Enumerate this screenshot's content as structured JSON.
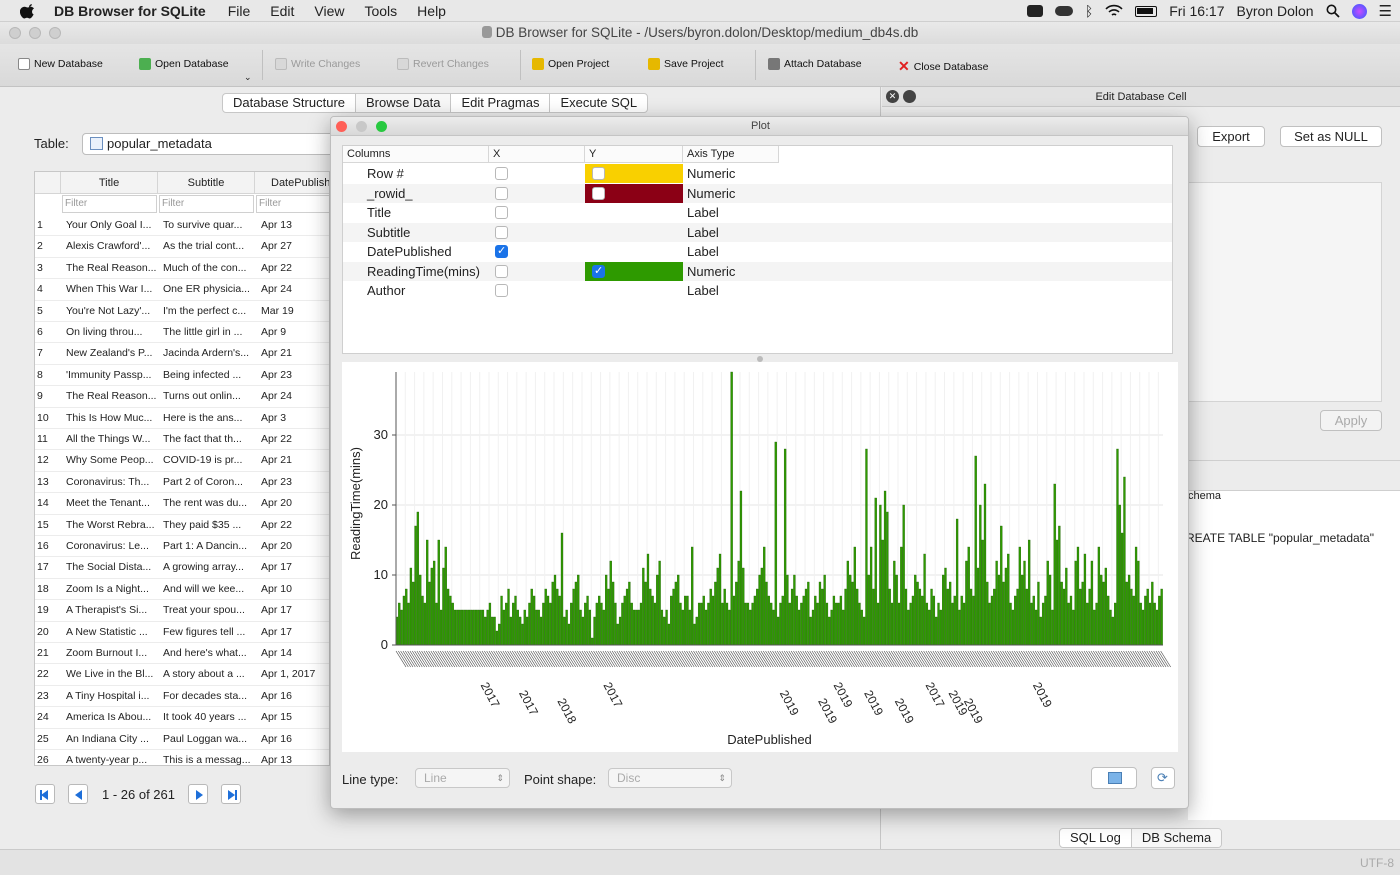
{
  "menubar": {
    "app_name": "DB Browser for SQLite",
    "items": [
      "File",
      "Edit",
      "View",
      "Tools",
      "Help"
    ],
    "clock": "Fri 16:17",
    "user": "Byron Dolon"
  },
  "window": {
    "title": "DB Browser for SQLite - /Users/byron.dolon/Desktop/medium_db4s.db"
  },
  "toolbar": {
    "new_db": "New Database",
    "open_db": "Open Database",
    "write": "Write Changes",
    "revert": "Revert Changes",
    "open_project": "Open Project",
    "save_project": "Save Project",
    "attach": "Attach Database",
    "close": "Close Database"
  },
  "tabs": [
    "Database Structure",
    "Browse Data",
    "Edit Pragmas",
    "Execute SQL"
  ],
  "browse": {
    "table_label": "Table:",
    "table_name": "popular_metadata",
    "columns": [
      "Title",
      "Subtitle",
      "DatePublished"
    ],
    "filter_placeholder": "Filter",
    "rows": [
      [
        "1",
        "Your Only Goal I...",
        "To survive quar...",
        "Apr 13"
      ],
      [
        "2",
        "Alexis Crawford'...",
        "As the trial cont...",
        "Apr 27"
      ],
      [
        "3",
        "The Real Reason...",
        "Much of the con...",
        "Apr 22"
      ],
      [
        "4",
        "When This War I...",
        "One ER physicia...",
        "Apr 24"
      ],
      [
        "5",
        "You're Not Lazy'...",
        "I'm the perfect c...",
        "Mar 19"
      ],
      [
        "6",
        "On living throu...",
        "The little girl in ...",
        "Apr 9"
      ],
      [
        "7",
        "New Zealand's P...",
        "Jacinda Ardern's...",
        "Apr 21"
      ],
      [
        "8",
        "'Immunity Passp...",
        "Being infected ...",
        "Apr 23"
      ],
      [
        "9",
        "The Real Reason...",
        "Turns out onlin...",
        "Apr 24"
      ],
      [
        "10",
        "This Is How Muc...",
        "Here is the ans...",
        "Apr 3"
      ],
      [
        "11",
        "All the Things W...",
        "The fact that th...",
        "Apr 22"
      ],
      [
        "12",
        "Why Some Peop...",
        "COVID-19 is pr...",
        "Apr 21"
      ],
      [
        "13",
        "Coronavirus: Th...",
        "Part 2 of Coron...",
        "Apr 23"
      ],
      [
        "14",
        "Meet the Tenant...",
        "The rent was du...",
        "Apr 20"
      ],
      [
        "15",
        "The Worst Rebra...",
        "They paid $35 ...",
        "Apr 22"
      ],
      [
        "16",
        "Coronavirus: Le...",
        "Part 1: A Dancin...",
        "Apr 20"
      ],
      [
        "17",
        "The Social Dista...",
        "A growing array...",
        "Apr 17"
      ],
      [
        "18",
        "Zoom Is a Night...",
        "And will we kee...",
        "Apr 10"
      ],
      [
        "19",
        "A Therapist's Si...",
        "Treat your spou...",
        "Apr 17"
      ],
      [
        "20",
        "A New Statistic ...",
        "Few figures tell ...",
        "Apr 17"
      ],
      [
        "21",
        "Zoom Burnout I...",
        "And here's what...",
        "Apr 14"
      ],
      [
        "22",
        "We Live in the Bl...",
        "A story about a ...",
        "Apr 1, 2017"
      ],
      [
        "23",
        "A Tiny Hospital i...",
        "For decades sta...",
        "Apr 16"
      ],
      [
        "24",
        "America Is Abou...",
        "It took 40 years ...",
        "Apr 15"
      ],
      [
        "25",
        "An Indiana City ...",
        "Paul Loggan wa...",
        "Apr 16"
      ],
      [
        "26",
        "A twenty-year p...",
        "This is a messag...",
        "Apr 13"
      ]
    ],
    "pagination": "1 - 26 of 261"
  },
  "right_panel": {
    "title": "Edit Database Cell",
    "export": "Export",
    "set_null": "Set as NULL",
    "apply": "Apply",
    "schema_header": "chema",
    "schema_create": "REATE TABLE \"popular_metadata\"",
    "bottom_tabs": [
      "SQL Log",
      "DB Schema"
    ]
  },
  "statusbar": {
    "encoding": "UTF-8"
  },
  "plot": {
    "title": "Plot",
    "headers": [
      "Columns",
      "X",
      "Y",
      "Axis Type"
    ],
    "columns": [
      {
        "name": "Row #",
        "x": false,
        "y": false,
        "color": "#f9d000",
        "axis": "Numeric"
      },
      {
        "name": "_rowid_",
        "x": false,
        "y": false,
        "color": "#8b0015",
        "axis": "Numeric"
      },
      {
        "name": "Title",
        "x": false,
        "y": null,
        "color": "",
        "axis": "Label"
      },
      {
        "name": "Subtitle",
        "x": false,
        "y": null,
        "color": "",
        "axis": "Label"
      },
      {
        "name": "DatePublished",
        "x": true,
        "y": null,
        "color": "",
        "axis": "Label"
      },
      {
        "name": "ReadingTime(mins)",
        "x": false,
        "y": true,
        "color": "#2e9a00",
        "axis": "Numeric"
      },
      {
        "name": "Author",
        "x": false,
        "y": null,
        "color": "",
        "axis": "Label"
      }
    ],
    "line_type_label": "Line type:",
    "line_type_value": "Line",
    "point_shape_label": "Point shape:",
    "point_shape_value": "Disc"
  },
  "chart_data": {
    "type": "bar",
    "xlabel": "DatePublished",
    "ylabel": "ReadingTime(mins)",
    "ylim": [
      0,
      39
    ],
    "yticks": [
      0,
      10,
      20,
      30
    ],
    "bar_color": "#2e9a00",
    "grid": true,
    "tick_labels_visible": [
      "2017",
      "2017",
      "2018",
      "2017",
      "2019",
      "2019",
      "2019",
      "2019",
      "2019",
      "2017",
      "2019",
      "2019",
      "2019"
    ],
    "values": [
      4,
      6,
      5,
      7,
      8,
      6,
      11,
      9,
      17,
      19,
      10,
      7,
      6,
      15,
      9,
      11,
      12,
      6,
      15,
      5,
      11,
      14,
      8,
      7,
      6,
      5,
      5,
      5,
      5,
      5,
      5,
      5,
      5,
      5,
      5,
      5,
      5,
      5,
      4,
      5,
      6,
      4,
      4,
      2,
      3,
      7,
      5,
      6,
      8,
      4,
      6,
      7,
      5,
      4,
      3,
      5,
      4,
      6,
      8,
      7,
      5,
      5,
      4,
      6,
      8,
      7,
      6,
      9,
      10,
      8,
      7,
      16,
      4,
      5,
      3,
      6,
      8,
      9,
      10,
      5,
      4,
      6,
      7,
      5,
      1,
      4,
      6,
      7,
      6,
      5,
      10,
      8,
      12,
      9,
      6,
      3,
      4,
      6,
      7,
      8,
      9,
      6,
      5,
      5,
      5,
      6,
      11,
      9,
      13,
      8,
      7,
      6,
      10,
      12,
      5,
      4,
      5,
      3,
      7,
      8,
      9,
      10,
      6,
      5,
      7,
      7,
      5,
      14,
      3,
      4,
      6,
      6,
      7,
      5,
      6,
      8,
      7,
      9,
      11,
      13,
      6,
      8,
      6,
      5,
      39,
      7,
      9,
      12,
      22,
      11,
      6,
      6,
      5,
      6,
      7,
      8,
      10,
      11,
      14,
      9,
      7,
      6,
      5,
      29,
      4,
      6,
      7,
      28,
      10,
      6,
      8,
      10,
      7,
      5,
      6,
      7,
      8,
      9,
      4,
      5,
      7,
      6,
      9,
      8,
      10,
      6,
      4,
      5,
      7,
      6,
      6,
      7,
      5,
      8,
      12,
      10,
      9,
      14,
      8,
      6,
      5,
      4,
      28,
      10,
      14,
      8,
      21,
      6,
      20,
      15,
      22,
      19,
      8,
      6,
      12,
      10,
      6,
      14,
      20,
      8,
      5,
      6,
      7,
      10,
      9,
      8,
      7,
      13,
      6,
      5,
      8,
      7,
      4,
      6,
      5,
      10,
      11,
      8,
      9,
      6,
      7,
      18,
      5,
      7,
      6,
      12,
      14,
      8,
      7,
      27,
      11,
      20,
      15,
      23,
      9,
      6,
      7,
      8,
      12,
      10,
      17,
      9,
      11,
      13,
      6,
      5,
      7,
      8,
      14,
      10,
      12,
      8,
      15,
      6,
      7,
      5,
      9,
      4,
      6,
      7,
      12,
      10,
      5,
      23,
      15,
      17,
      9,
      8,
      11,
      6,
      7,
      5,
      12,
      14,
      8,
      9,
      13,
      6,
      8,
      12,
      5,
      6,
      14,
      10,
      9,
      11,
      7,
      5,
      4,
      6,
      28,
      20,
      16,
      24,
      9,
      10,
      8,
      7,
      14,
      12,
      6,
      5,
      7,
      8,
      6,
      9,
      6,
      5,
      7,
      8
    ]
  }
}
